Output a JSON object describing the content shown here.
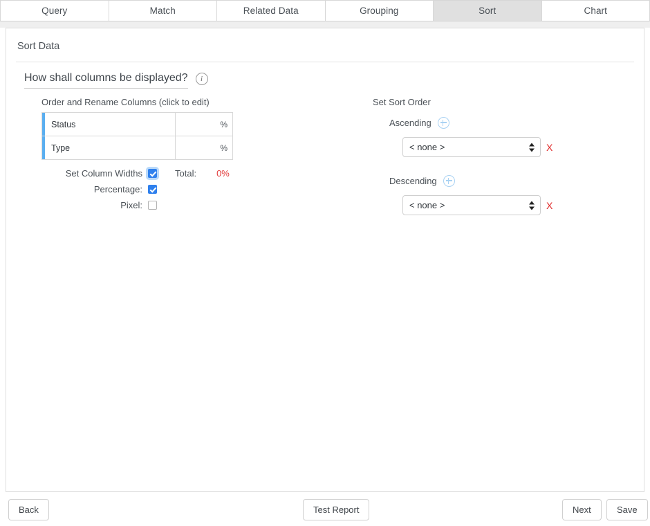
{
  "tabs": [
    {
      "label": "Query",
      "active": false
    },
    {
      "label": "Match",
      "active": false
    },
    {
      "label": "Related Data",
      "active": false
    },
    {
      "label": "Grouping",
      "active": false
    },
    {
      "label": "Sort",
      "active": true
    },
    {
      "label": "Chart",
      "active": false
    }
  ],
  "panel": {
    "title": "Sort Data",
    "section_heading": "How shall columns be displayed?",
    "info_icon_glyph": "i"
  },
  "columns_panel": {
    "label": "Order and Rename Columns (click to edit)",
    "rows": [
      {
        "name": "Status",
        "width": "",
        "unit": "%"
      },
      {
        "name": "Type",
        "width": "",
        "unit": "%"
      }
    ],
    "checkboxes": [
      {
        "label": "Set Column Widths",
        "checked": true,
        "focused": true
      },
      {
        "label": "Percentage:",
        "checked": true,
        "focused": false
      },
      {
        "label": "Pixel:",
        "checked": false,
        "focused": false
      }
    ],
    "total_label": "Total:",
    "total_value": "0%",
    "total_color": "#e23b3b"
  },
  "sort_order": {
    "title": "Set Sort Order",
    "groups": [
      {
        "label": "Ascending",
        "add_icon": "plus-circle-icon",
        "selected": "< none >",
        "options": [
          "< none >"
        ],
        "remove_label": "X"
      },
      {
        "label": "Descending",
        "add_icon": "plus-circle-icon",
        "selected": "< none >",
        "options": [
          "< none >"
        ],
        "remove_label": "X"
      }
    ]
  },
  "footer": {
    "back": "Back",
    "test_report": "Test Report",
    "next": "Next",
    "save": "Save"
  },
  "colors": {
    "accent_blue": "#5aaef0",
    "checkbox_blue": "#2f80ed",
    "danger_red": "#e02b2b",
    "active_tab_bg": "#e0e0e0"
  }
}
